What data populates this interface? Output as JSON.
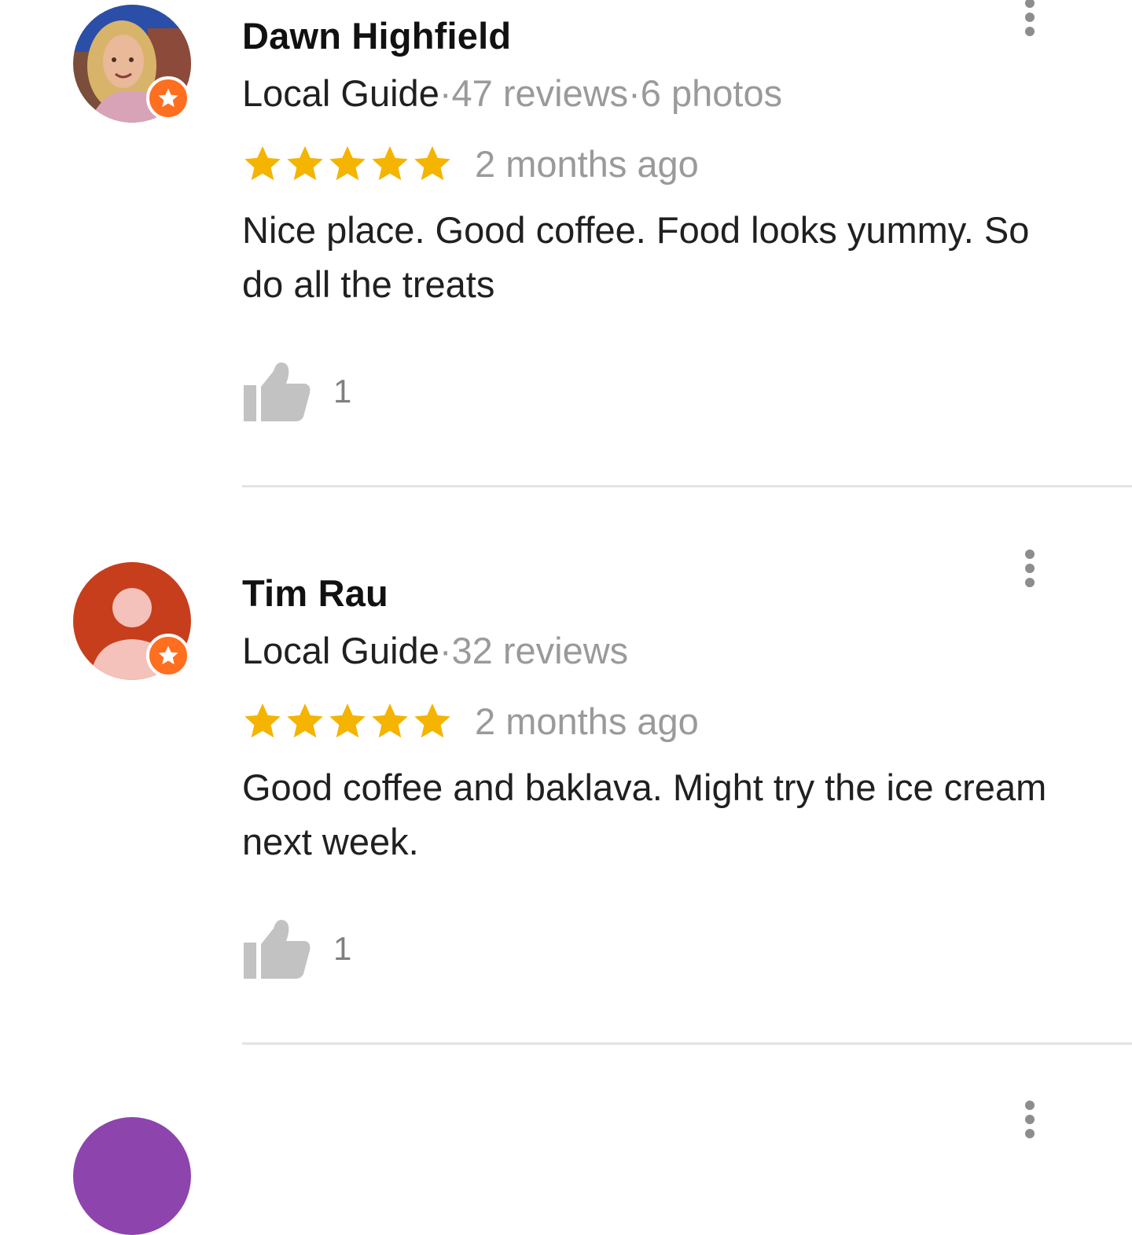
{
  "reviews": [
    {
      "name": "Dawn Highfield",
      "guide_label": "Local Guide",
      "stats": "·47 reviews·6 photos",
      "rating": 5,
      "time": "2 months ago",
      "text": "Nice place. Good coffee. Food looks yummy. So do all the treats",
      "likes": "1"
    },
    {
      "name": "Tim Rau",
      "guide_label": "Local Guide",
      "stats": "·32 reviews",
      "rating": 5,
      "time": "2 months ago",
      "text": "Good coffee and baklava. Might try the ice cream next week.",
      "likes": "1"
    }
  ],
  "colors": {
    "star": "#f4b400",
    "badge": "#ff6f1f",
    "avatar_tim": "#c73e1d",
    "avatar_next": "#8e44ad"
  }
}
